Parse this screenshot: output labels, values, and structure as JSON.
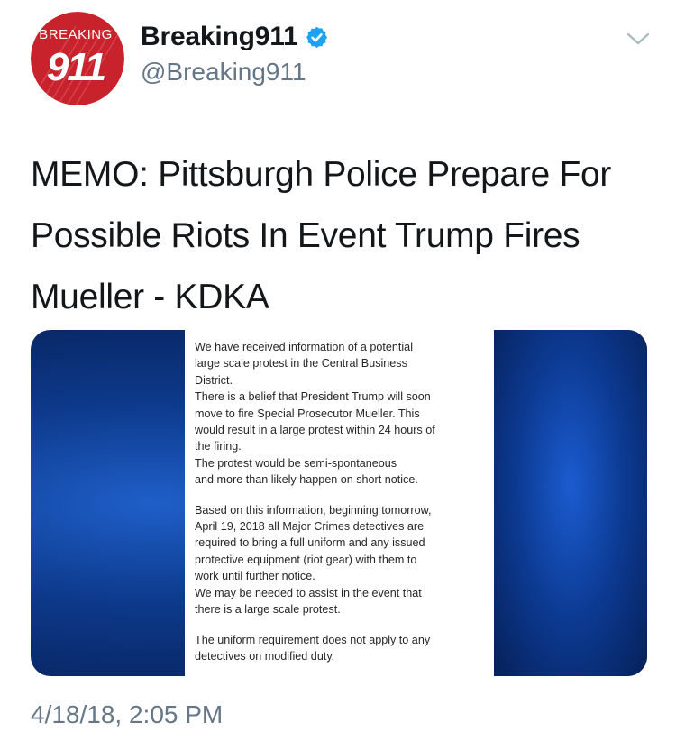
{
  "author": {
    "display_name": "Breaking911",
    "handle": "@Breaking911",
    "verified": true,
    "avatar_logo_text": "BREAKING 911"
  },
  "icons": {
    "verified": "verified-badge-icon",
    "menu": "chevron-down-icon"
  },
  "tweet": {
    "text": "MEMO: Pittsburgh Police Prepare For Possible Riots In Event Trump Fires Mueller - KDKA",
    "timestamp": "4/18/18, 2:05 PM"
  },
  "media": {
    "paragraphs": [
      "We have received information of a potential\nlarge scale protest in the Central Business\nDistrict.\nThere is a belief that President Trump will soon\nmove to fire Special Prosecutor Mueller. This\nwould result in a large protest within 24 hours of\nthe firing.\nThe protest would be semi-spontaneous\nand more than likely happen on short notice.",
      "Based on this information, beginning tomorrow,\nApril 19, 2018 all Major Crimes detectives are\nrequired to bring a full uniform and any issued\nprotective equipment (riot gear) with them to\nwork until further notice.\nWe may be needed to assist in the event that\nthere is a large scale protest.",
      "The uniform requirement does not apply to any\ndetectives on modified duty."
    ]
  },
  "colors": {
    "text_primary": "#14171a",
    "text_secondary": "#657786",
    "verified_blue": "#1da1f2",
    "avatar_red": "#c8232c",
    "media_blue": "#0d3a8c"
  }
}
